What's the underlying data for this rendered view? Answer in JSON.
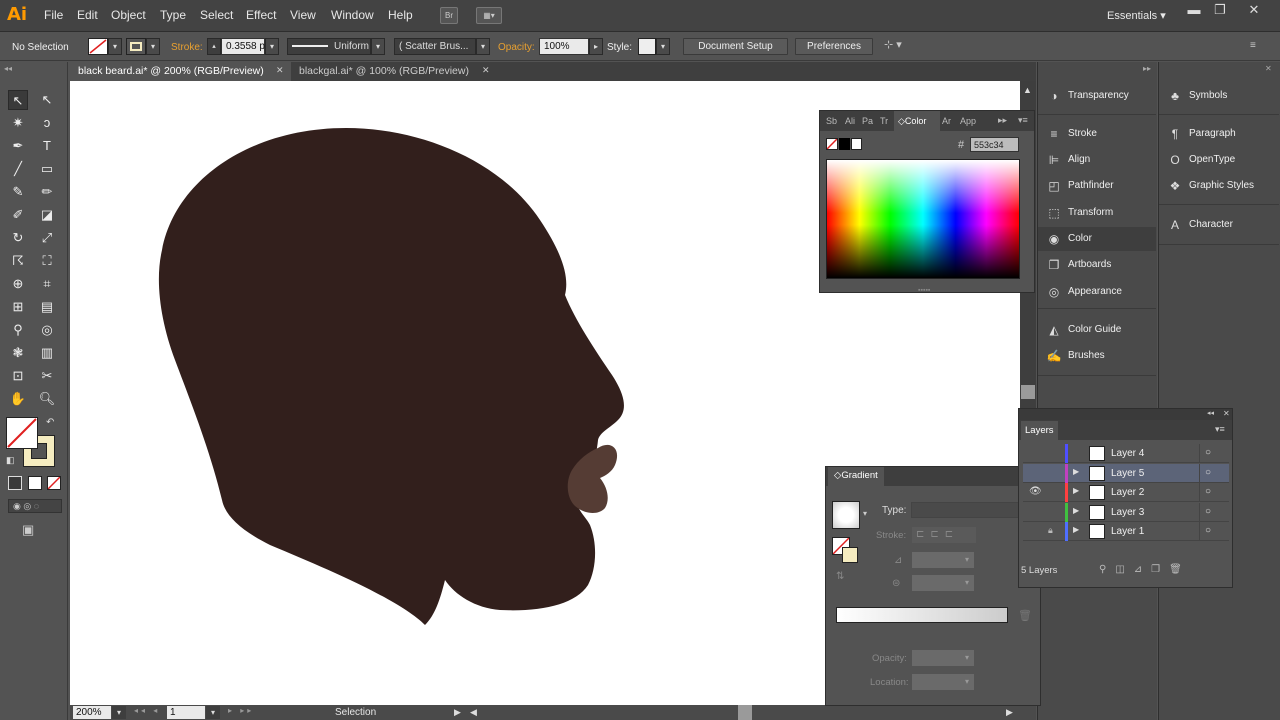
{
  "app": {
    "logo": "Ai",
    "workspace": "Essentials",
    "menu": [
      "File",
      "Edit",
      "Object",
      "Type",
      "Select",
      "Effect",
      "View",
      "Window",
      "Help"
    ],
    "bridge_label": "Br"
  },
  "control_bar": {
    "selection_label": "No Selection",
    "stroke_label": "Stroke:",
    "stroke_value": "0.3558 p",
    "stroke_profile": "Uniform",
    "brush": "Scatter Brus...",
    "opacity_label": "Opacity:",
    "opacity_value": "100%",
    "style_label": "Style:",
    "doc_setup": "Document Setup",
    "preferences": "Preferences"
  },
  "tabs": [
    {
      "label": "black beard.ai* @ 200% (RGB/Preview)",
      "active": true
    },
    {
      "label": "blackgal.ai* @ 100% (RGB/Preview)",
      "active": false
    }
  ],
  "colors": {
    "head": "#321f1c",
    "lips": "#553c34",
    "accent": "#ff9a00"
  },
  "color_panel": {
    "tabs": [
      "Sb",
      "Ali",
      "Pa",
      "Tr",
      "Color",
      "Ar",
      "App"
    ],
    "active_tab": "Color",
    "hex_value": "553c34",
    "hash": "#"
  },
  "dock_left": [
    {
      "label": "Transparency",
      "icon": "transparency-icon"
    },
    {
      "label": "Stroke",
      "icon": "stroke-icon"
    },
    {
      "label": "Align",
      "icon": "align-icon"
    },
    {
      "label": "Pathfinder",
      "icon": "pathfinder-icon"
    },
    {
      "label": "Transform",
      "icon": "transform-icon"
    },
    {
      "label": "Color",
      "icon": "color-icon"
    },
    {
      "label": "Artboards",
      "icon": "artboards-icon"
    },
    {
      "label": "Appearance",
      "icon": "appearance-icon"
    },
    {
      "label": "Color Guide",
      "icon": "color-guide-icon"
    },
    {
      "label": "Brushes",
      "icon": "brushes-icon"
    }
  ],
  "dock_right": [
    {
      "label": "Symbols",
      "icon": "symbols-icon"
    },
    {
      "label": "Paragraph",
      "icon": "paragraph-icon"
    },
    {
      "label": "OpenType",
      "icon": "opentype-icon"
    },
    {
      "label": "Graphic Styles",
      "icon": "graphic-styles-icon"
    },
    {
      "label": "Character",
      "icon": "character-icon"
    }
  ],
  "gradient_panel": {
    "title": "Gradient",
    "type_label": "Type:",
    "stroke_label": "Stroke:",
    "opacity_label": "Opacity:",
    "location_label": "Location:"
  },
  "layers_panel": {
    "title": "Layers",
    "footer": "5 Layers",
    "layers": [
      {
        "name": "Layer 4",
        "color": "#4f4fff",
        "selected": false,
        "visible": false,
        "locked": false,
        "expandable": false
      },
      {
        "name": "Layer 5",
        "color": "#c040c0",
        "selected": true,
        "visible": false,
        "locked": false,
        "expandable": true
      },
      {
        "name": "Layer 2",
        "color": "#ff4040",
        "selected": false,
        "visible": true,
        "locked": false,
        "expandable": true
      },
      {
        "name": "Layer 3",
        "color": "#40c040",
        "selected": false,
        "visible": false,
        "locked": false,
        "expandable": true
      },
      {
        "name": "Layer 1",
        "color": "#4f6fff",
        "selected": false,
        "visible": false,
        "locked": true,
        "expandable": true
      }
    ]
  },
  "status": {
    "zoom": "200%",
    "artboard": "1",
    "tool": "Selection"
  }
}
